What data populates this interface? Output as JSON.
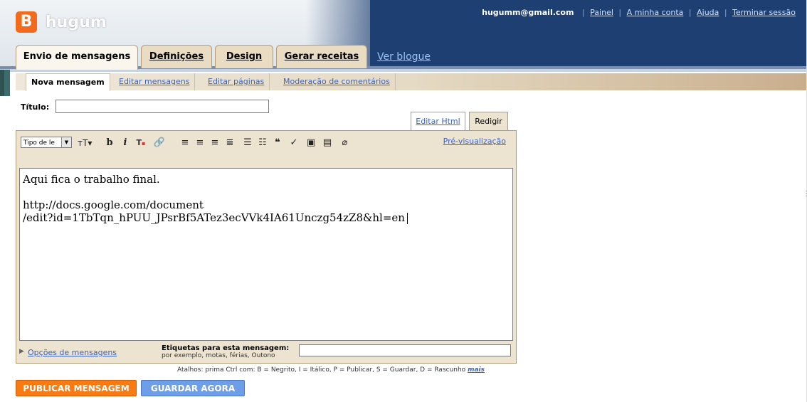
{
  "header": {
    "logo_glyph": "B",
    "blog_name": "hugum",
    "email": "hugumm@gmail.com",
    "links": [
      "Painel",
      "A minha conta",
      "Ajuda",
      "Terminar sessão"
    ]
  },
  "main_tabs": [
    "Envio de mensagens",
    "Definições",
    "Design",
    "Gerar receitas"
  ],
  "view_blog": "Ver blogue",
  "sub_tabs": [
    "Nova mensagem",
    "Editar mensagens",
    "Editar páginas",
    "Moderação de comentários"
  ],
  "post": {
    "title_label": "Título:",
    "title_value": "",
    "mode_tabs": [
      "Editar Html",
      "Redigir"
    ],
    "font_select": "Tipo de le",
    "preview_link": "Pré-visualização",
    "body_lines": [
      "Aqui fica o trabalho final.",
      "",
      "http://docs.google.com/document",
      "/edit?id=1TbTqn_hPUU_JPsrBf5ATez3ecVVk4IA61Unczg54zZ8&hl=en"
    ],
    "options_link": "Opções de mensagens",
    "tags_label": "Etiquetas para esta mensagem:",
    "tags_example": "por exemplo, motas, férias, Outono",
    "tags_value": ""
  },
  "shortcuts": {
    "text": "Atalhos: prima Ctrl com: B = Negrito, I = Itálico, P = Publicar, S = Guardar, D = Rascunho",
    "more": "mais"
  },
  "buttons": {
    "publish": "PUBLICAR MENSAGEM",
    "save": "GUARDAR AGORA"
  },
  "colors": {
    "header_blue": "#1d3f72",
    "publish_orange": "#f77a12",
    "save_blue": "#6e9ee8",
    "link_blue": "#3d63b8"
  }
}
